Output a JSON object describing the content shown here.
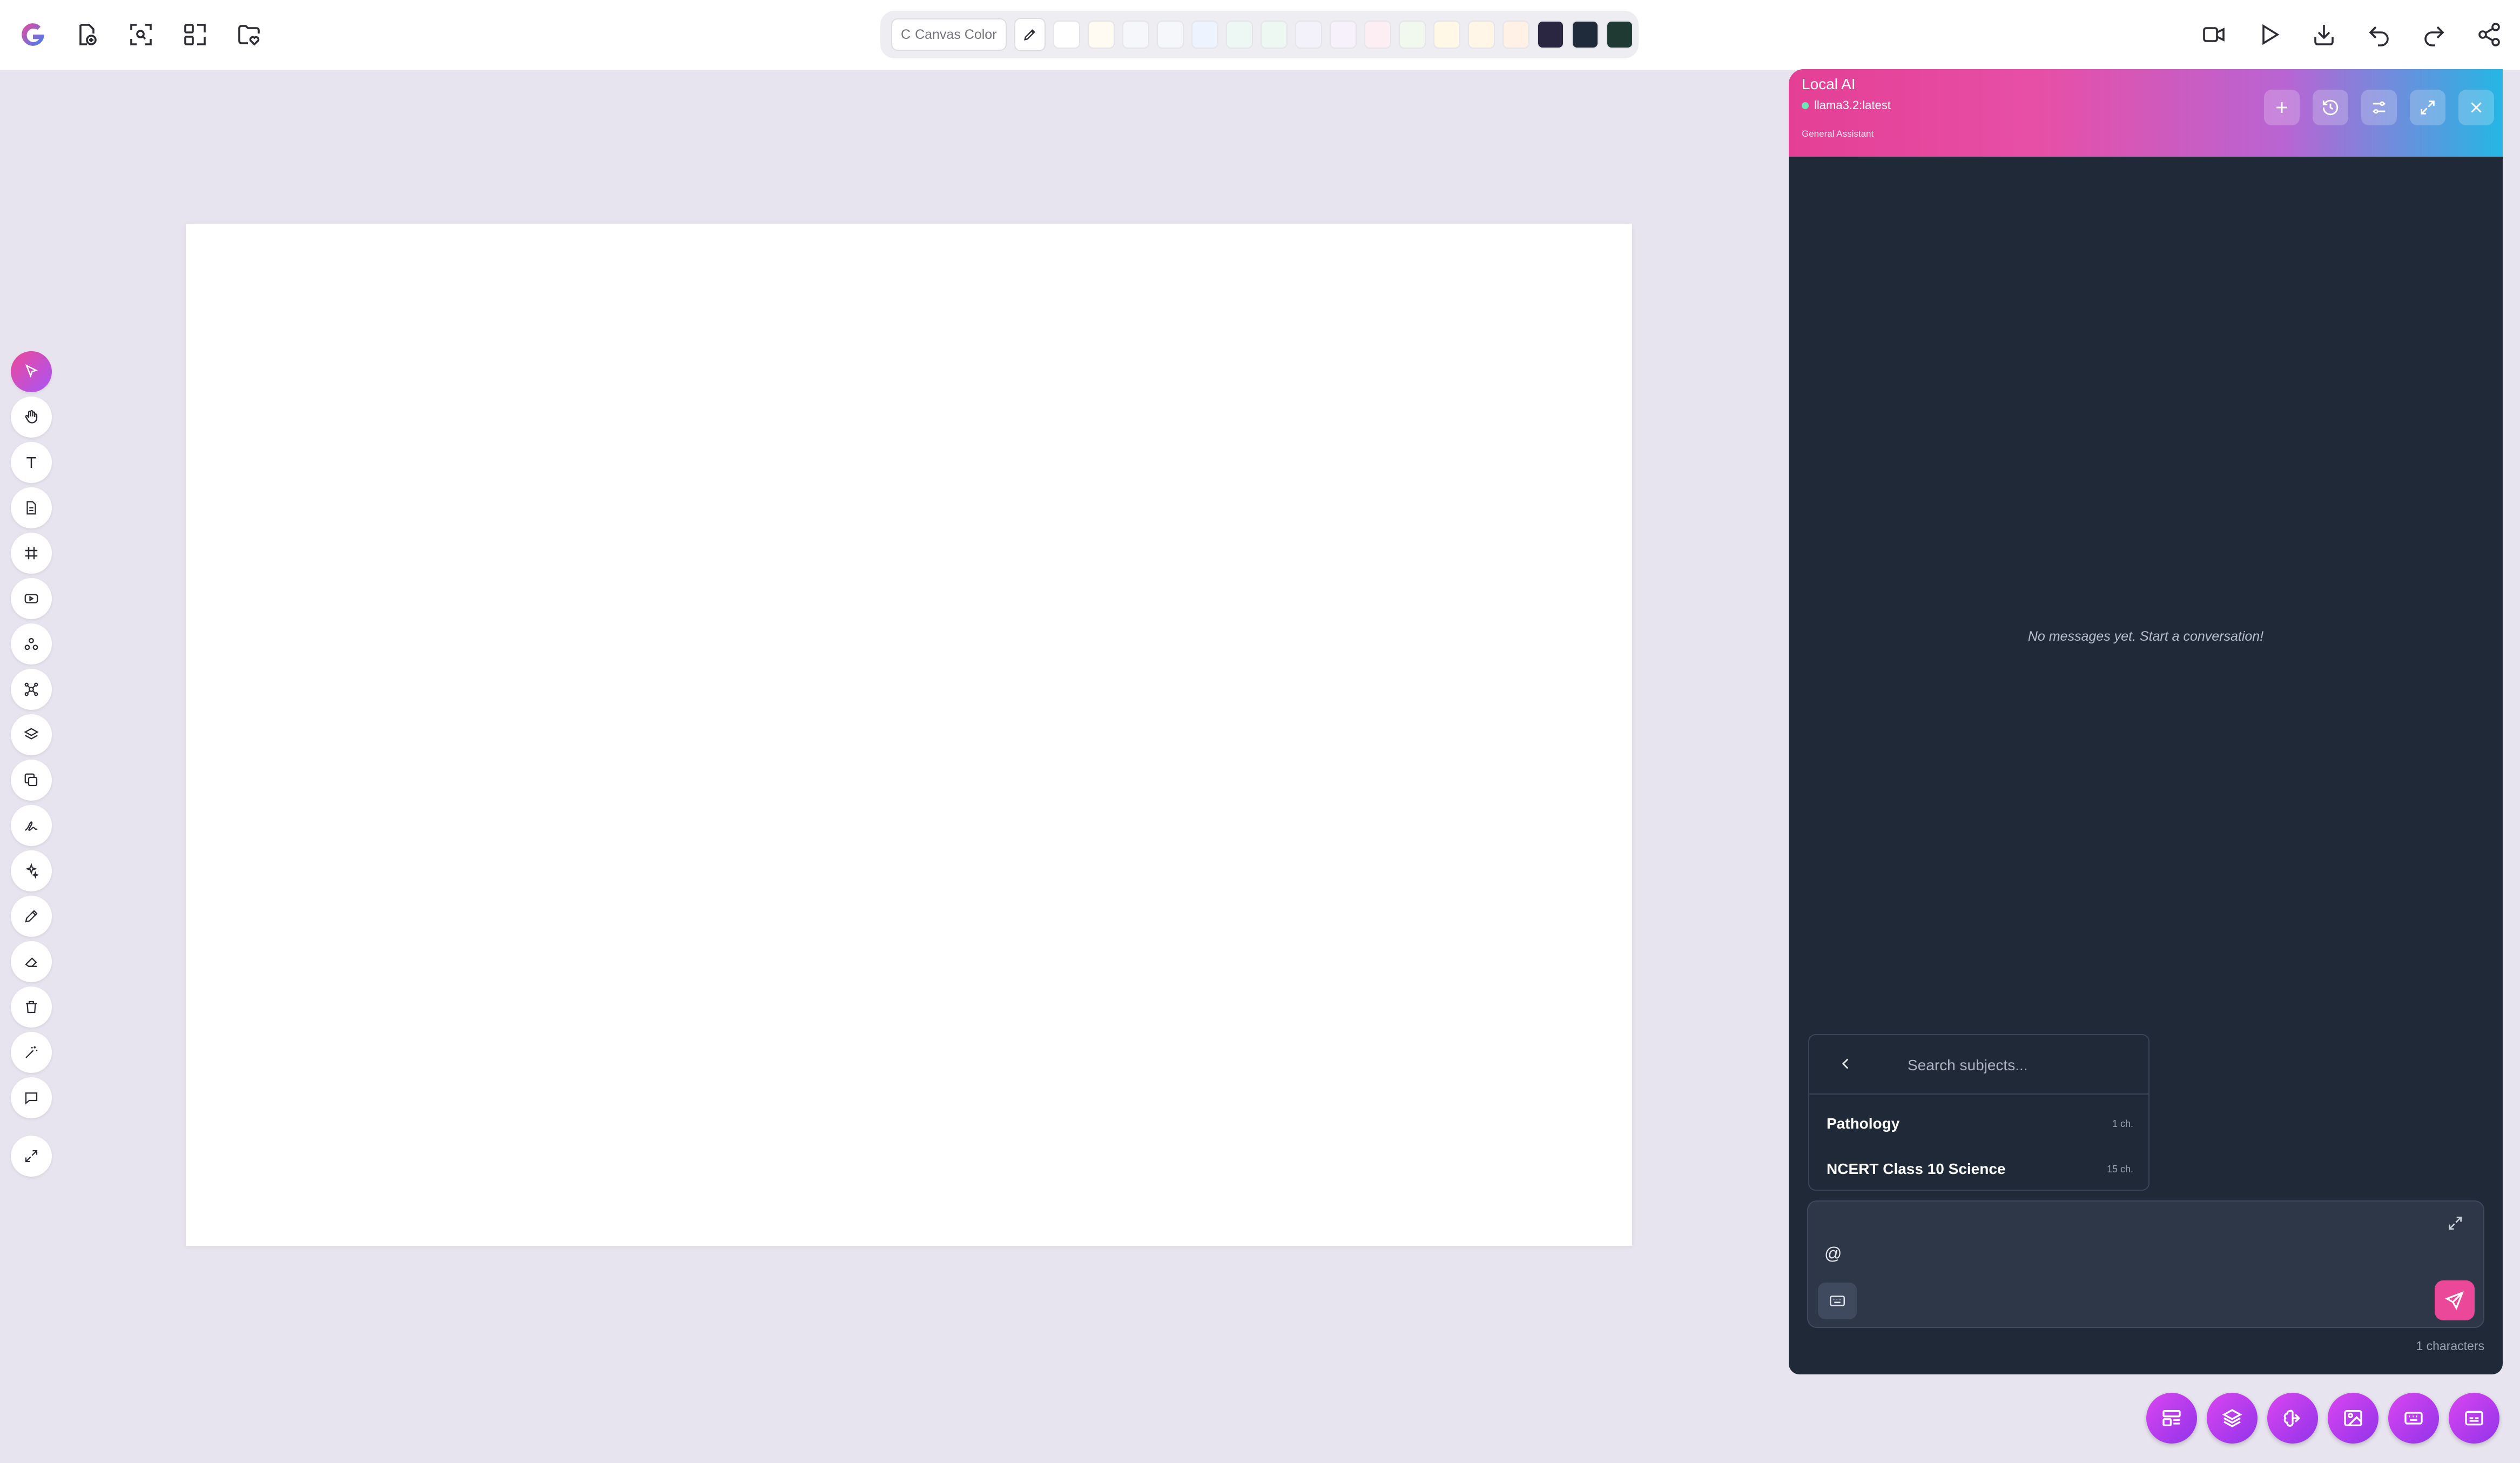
{
  "palette": {
    "canvas_color_label": "Canvas Color",
    "canvas_color_glyph": "C",
    "swatches": [
      "#ffffff",
      "#fffaf2",
      "#f6f7fb",
      "#f5f7fa",
      "#eef4ff",
      "#edf8f5",
      "#eef8f3",
      "#f3f1fa",
      "#f7f1fb",
      "#fdeef3",
      "#f1f9ef",
      "#fff8e6",
      "#fff6e8",
      "#fff1e6",
      "#2a2540",
      "#1f2b3a",
      "#1e3a32"
    ]
  },
  "ai_panel": {
    "title": "Local AI",
    "model": "llama3.2:latest",
    "subtitle": "General Assistant",
    "empty_message": "No messages yet. Start a conversation!",
    "subject_search": {
      "placeholder": "Search subjects...",
      "items": [
        {
          "name": "Pathology",
          "count": "1 ch."
        },
        {
          "name": "NCERT Class 10 Science",
          "count": "15 ch."
        }
      ]
    },
    "composer": {
      "text": "@",
      "char_count": "1 characters"
    }
  },
  "colors": {
    "accent": "#ec4899",
    "panel_bg": "#202938",
    "canvas_bg": "#e8e4ef"
  }
}
